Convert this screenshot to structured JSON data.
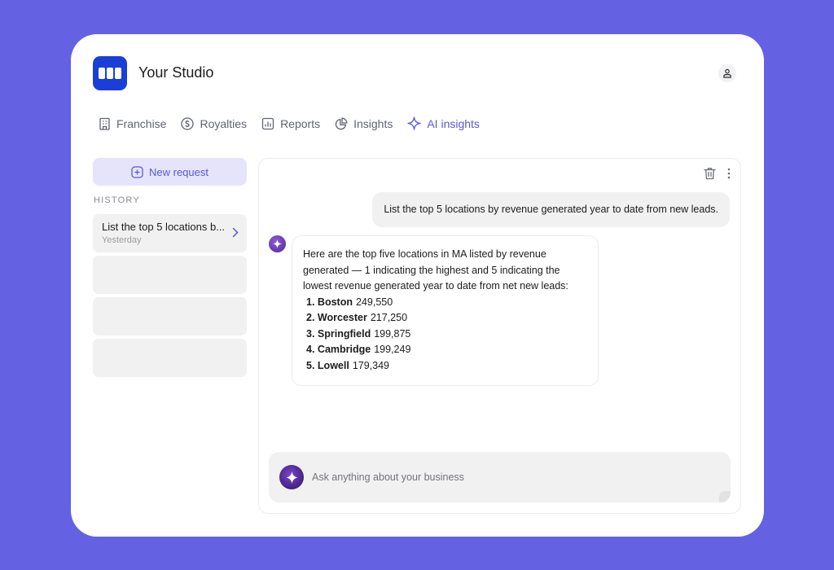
{
  "app": {
    "title": "Your Studio"
  },
  "colors": {
    "background": "#6462e2",
    "brand": "#1a3fd9",
    "accent": "#5a58d6",
    "accent_soft": "#e5e4fb"
  },
  "nav": {
    "items": [
      {
        "label": "Franchise",
        "icon": "building-icon",
        "active": false
      },
      {
        "label": "Royalties",
        "icon": "dollar-circle-icon",
        "active": false
      },
      {
        "label": "Reports",
        "icon": "bar-chart-icon",
        "active": false
      },
      {
        "label": "Insights",
        "icon": "pie-chart-icon",
        "active": false
      },
      {
        "label": "AI insights",
        "icon": "sparkle-icon",
        "active": true
      }
    ]
  },
  "sidebar": {
    "new_request_label": "New request",
    "history_label": "HISTORY",
    "history": [
      {
        "title": "List the top 5 locations b...",
        "subtitle": "Yesterday"
      }
    ]
  },
  "chat": {
    "user_message": "List the top 5 locations by revenue generated year to date from new leads.",
    "ai_intro": "Here are the top five locations in MA listed by revenue generated — 1 indicating the highest and 5 indicating the lowest revenue generated year to date from net new leads:",
    "ranking": [
      {
        "rank": "1.",
        "name": "Boston",
        "value": "249,550"
      },
      {
        "rank": "2.",
        "name": "Worcester",
        "value": "217,250"
      },
      {
        "rank": "3.",
        "name": "Springfield",
        "value": "199,875"
      },
      {
        "rank": "4.",
        "name": "Cambridge",
        "value": "199,249"
      },
      {
        "rank": "5.",
        "name": "Lowell",
        "value": "179,349"
      }
    ],
    "composer": {
      "placeholder": "Ask anything about your business",
      "value": ""
    }
  }
}
